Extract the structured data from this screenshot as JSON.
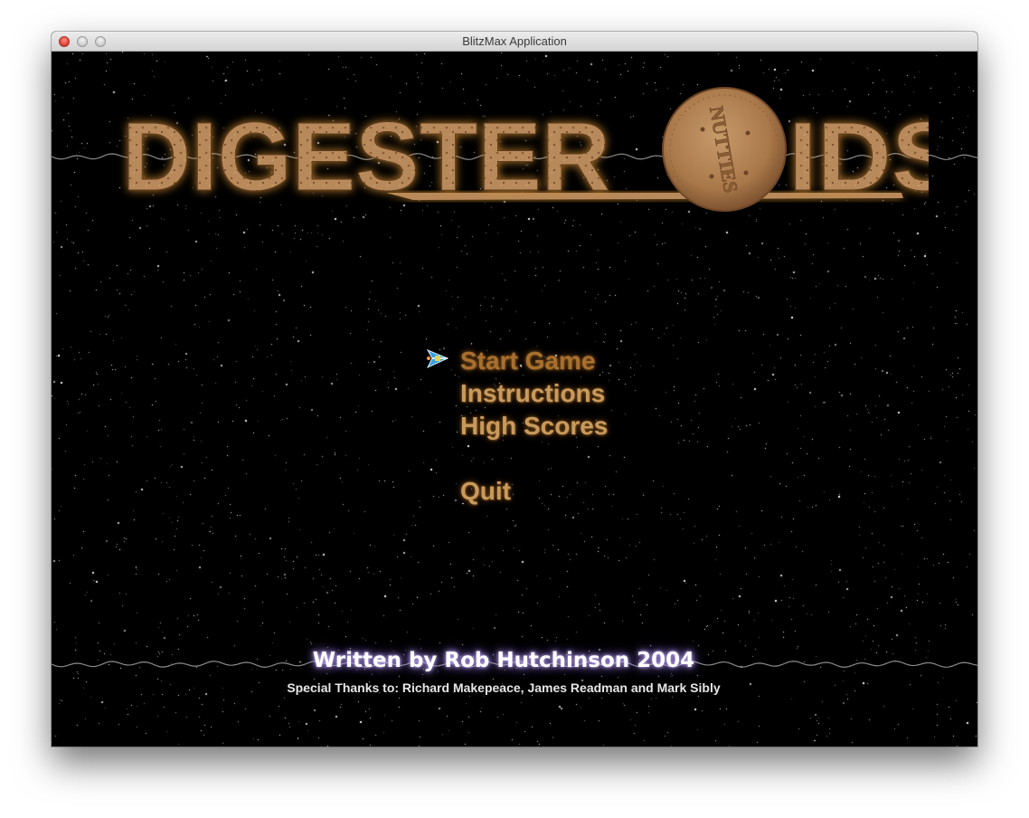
{
  "window": {
    "title": "BlitzMax Application"
  },
  "game": {
    "logo_text": "DIGESTEROIDS",
    "biscuit_stamp": "NUTTIES",
    "menu": [
      {
        "label": "Start Game",
        "selected": true
      },
      {
        "label": "Instructions",
        "selected": false
      },
      {
        "label": "High Scores",
        "selected": false
      },
      {
        "label": "Quit",
        "selected": false
      }
    ],
    "selector_icon": "spaceship-icon",
    "credit": "Written by Rob Hutchinson 2004",
    "thanks": "Special Thanks to: Richard Makepeace, James Readman and Mark Sibly"
  },
  "colors": {
    "menu_text": "#c89a5c",
    "menu_selected": "#a8702e",
    "logo_fill": "#b98a5a",
    "credit_glow": "#c7b3ff",
    "background": "#000000"
  }
}
